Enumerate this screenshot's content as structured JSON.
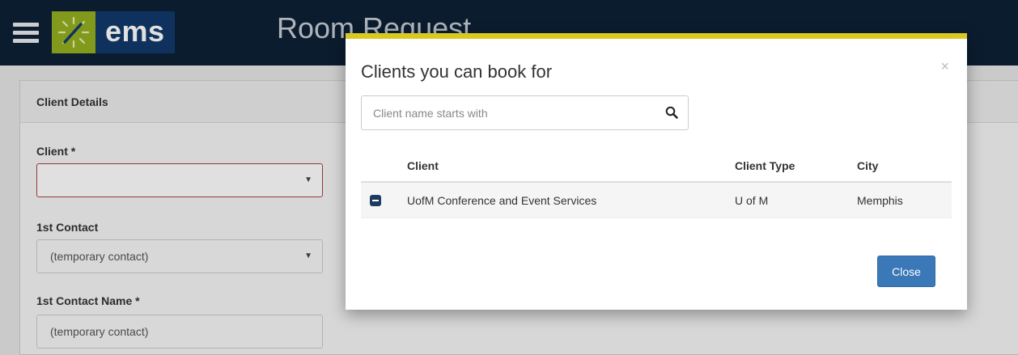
{
  "app": {
    "logo_text": "ems",
    "page_title": "Room Request"
  },
  "form": {
    "panel_title": "Client Details",
    "client_label": "Client *",
    "client_value": "",
    "contact_label": "1st Contact",
    "contact_value": "(temporary contact)",
    "contact_name_label": "1st Contact Name *",
    "contact_name_value": "(temporary contact)"
  },
  "modal": {
    "title": "Clients you can book for",
    "close_glyph": "×",
    "search_placeholder": "Client name starts with",
    "columns": [
      "Client",
      "Client Type",
      "City"
    ],
    "rows": [
      {
        "client": "UofM Conference and Event Services",
        "type": "U of M",
        "city": "Memphis"
      }
    ],
    "close_button": "Close"
  },
  "colors": {
    "topbar": "#0d2036",
    "accent": "#d8c821",
    "primary_button": "#3a78b7",
    "logo_green": "#95b020",
    "logo_blue": "#11396a"
  }
}
